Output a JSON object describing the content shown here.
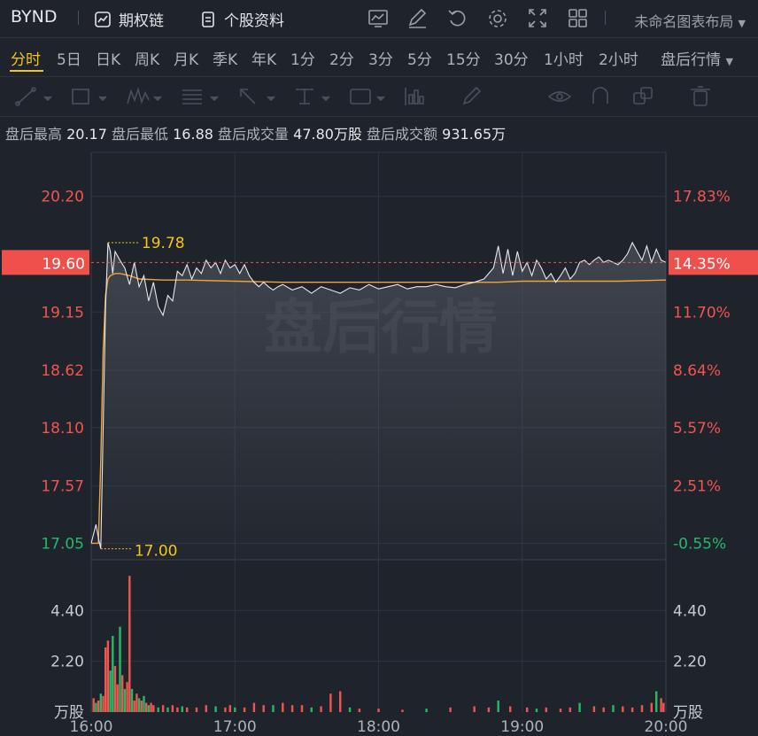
{
  "header": {
    "ticker": "BYND",
    "options_chain": "期权链",
    "stock_profile": "个股资料",
    "layout_name": "未命名图表布局",
    "icons": [
      "chart-icon",
      "edit-icon",
      "undo-icon",
      "settings-icon",
      "fullscreen-icon",
      "grid-icon"
    ]
  },
  "timeframes": {
    "items": [
      "分时",
      "5日",
      "日K",
      "周K",
      "月K",
      "季K",
      "年K",
      "1分",
      "2分",
      "3分",
      "5分",
      "15分",
      "30分",
      "1小时",
      "2小时"
    ],
    "active": "分时",
    "session": "盘后行情"
  },
  "drawing_tools": [
    "line-tool-icon",
    "rect-tool-icon",
    "pattern-tool-icon",
    "fib-tool-icon",
    "arrow-tool-icon",
    "measure-tool-icon",
    "text-tool-icon",
    "indicator-tool-icon",
    "pen-tool-icon",
    "eye-icon",
    "magnet-icon",
    "layers-icon",
    "trash-icon"
  ],
  "stats": {
    "high_label": "盘后最高",
    "high": "20.17",
    "low_label": "盘后最低",
    "low": "16.88",
    "volume_label": "盘后成交量",
    "volume": "47.80万股",
    "amount_label": "盘后成交额",
    "amount": "931.65万"
  },
  "chart_data": {
    "type": "line",
    "watermark": "盘后行情",
    "x_ticks": [
      "16:00",
      "17:00",
      "18:00",
      "19:00",
      "20:00"
    ],
    "y_ticks_price": [
      "20.20",
      "19.15",
      "18.62",
      "18.10",
      "17.57",
      "17.05"
    ],
    "y_ticks_pct": [
      "17.83%",
      "11.70%",
      "8.64%",
      "5.57%",
      "2.51%",
      "-0.55%"
    ],
    "y_ticks_price_values": [
      20.2,
      19.15,
      18.62,
      18.1,
      17.57,
      17.05
    ],
    "current_price": "19.60",
    "current_price_value": 19.6,
    "current_pct": "14.35%",
    "high_marker": "19.78",
    "high_marker_value": 19.78,
    "low_marker": "17.00",
    "low_marker_value": 17.0,
    "ylim": [
      16.9,
      20.6
    ],
    "price": {
      "t": [
        0,
        2,
        3,
        4,
        6,
        7,
        8,
        9,
        10,
        12,
        14,
        16,
        18,
        20,
        22,
        24,
        26,
        28,
        30,
        32,
        34,
        36,
        38,
        40,
        42,
        44,
        46,
        48,
        50,
        52,
        54,
        56,
        58,
        60,
        62,
        64,
        66,
        68,
        70,
        72,
        74,
        76,
        78,
        80,
        84,
        88,
        92,
        96,
        100,
        104,
        108,
        112,
        116,
        120,
        124,
        128,
        132,
        136,
        140,
        144,
        148,
        152,
        156,
        160,
        164,
        168,
        170,
        172,
        174,
        176,
        178,
        180,
        182,
        184,
        186,
        188,
        190,
        192,
        194,
        196,
        198,
        200,
        202,
        204,
        206,
        208,
        210,
        212,
        214,
        216,
        218,
        220,
        222,
        224,
        226,
        228,
        230,
        232,
        234,
        236,
        238,
        240
      ],
      "v": [
        17.05,
        17.22,
        17.1,
        17.0,
        19.2,
        19.78,
        19.7,
        19.5,
        19.7,
        19.62,
        19.55,
        19.4,
        19.6,
        19.38,
        19.48,
        19.25,
        19.42,
        19.2,
        19.12,
        19.3,
        19.25,
        19.52,
        19.48,
        19.58,
        19.45,
        19.55,
        19.5,
        19.62,
        19.55,
        19.6,
        19.5,
        19.62,
        19.55,
        19.58,
        19.5,
        19.58,
        19.48,
        19.42,
        19.38,
        19.42,
        19.38,
        19.35,
        19.38,
        19.4,
        19.35,
        19.38,
        19.32,
        19.38,
        19.35,
        19.32,
        19.37,
        19.35,
        19.4,
        19.36,
        19.38,
        19.4,
        19.36,
        19.38,
        19.38,
        19.4,
        19.38,
        19.37,
        19.4,
        19.42,
        19.45,
        19.55,
        19.75,
        19.5,
        19.72,
        19.48,
        19.7,
        19.52,
        19.6,
        19.48,
        19.62,
        19.55,
        19.45,
        19.5,
        19.42,
        19.48,
        19.55,
        19.45,
        19.5,
        19.6,
        19.62,
        19.58,
        19.62,
        19.65,
        19.6,
        19.62,
        19.6,
        19.58,
        19.62,
        19.68,
        19.78,
        19.7,
        19.62,
        19.75,
        19.6,
        19.72,
        19.62,
        19.6
      ]
    },
    "avg": {
      "t": [
        0,
        3,
        4,
        5,
        6,
        7,
        8,
        10,
        12,
        16,
        20,
        30,
        40,
        60,
        80,
        100,
        120,
        140,
        160,
        170,
        180,
        200,
        220,
        240
      ],
      "v": [
        17.05,
        17.05,
        17.8,
        18.8,
        19.3,
        19.45,
        19.48,
        19.5,
        19.5,
        19.48,
        19.45,
        19.44,
        19.44,
        19.43,
        19.42,
        19.42,
        19.42,
        19.42,
        19.42,
        19.42,
        19.43,
        19.43,
        19.43,
        19.44
      ]
    },
    "volume": {
      "unit": "万股",
      "ticks": [
        "4.40",
        "2.20"
      ],
      "tick_values": [
        4.4,
        2.2
      ],
      "bars": [
        [
          1,
          0.6,
          "r"
        ],
        [
          2,
          0.4,
          "g"
        ],
        [
          3,
          0.5,
          "r"
        ],
        [
          4,
          0.8,
          "g"
        ],
        [
          5,
          0.7,
          "r"
        ],
        [
          6,
          2.8,
          "r"
        ],
        [
          7,
          3.1,
          "r"
        ],
        [
          8,
          1.8,
          "g"
        ],
        [
          9,
          3.3,
          "g"
        ],
        [
          10,
          2.0,
          "r"
        ],
        [
          11,
          1.2,
          "r"
        ],
        [
          12,
          3.7,
          "g"
        ],
        [
          13,
          1.6,
          "r"
        ],
        [
          14,
          1.0,
          "g"
        ],
        [
          15,
          1.3,
          "r"
        ],
        [
          16,
          5.9,
          "r"
        ],
        [
          17,
          1.0,
          "g"
        ],
        [
          18,
          0.5,
          "r"
        ],
        [
          19,
          0.8,
          "r"
        ],
        [
          20,
          0.6,
          "g"
        ],
        [
          21,
          0.5,
          "r"
        ],
        [
          22,
          0.7,
          "g"
        ],
        [
          23,
          0.4,
          "r"
        ],
        [
          24,
          0.3,
          "g"
        ],
        [
          25,
          0.4,
          "r"
        ],
        [
          26,
          0.3,
          "r"
        ],
        [
          28,
          0.2,
          "g"
        ],
        [
          30,
          0.3,
          "r"
        ],
        [
          32,
          0.2,
          "g"
        ],
        [
          34,
          0.3,
          "r"
        ],
        [
          36,
          0.2,
          "r"
        ],
        [
          38,
          0.25,
          "g"
        ],
        [
          40,
          0.2,
          "r"
        ],
        [
          44,
          0.2,
          "r"
        ],
        [
          48,
          0.3,
          "r"
        ],
        [
          52,
          0.25,
          "g"
        ],
        [
          56,
          0.2,
          "r"
        ],
        [
          58,
          0.3,
          "r"
        ],
        [
          60,
          0.2,
          "g"
        ],
        [
          64,
          0.2,
          "r"
        ],
        [
          68,
          0.4,
          "r"
        ],
        [
          72,
          0.3,
          "r"
        ],
        [
          76,
          0.3,
          "g"
        ],
        [
          80,
          0.4,
          "r"
        ],
        [
          84,
          0.3,
          "r"
        ],
        [
          88,
          0.3,
          "r"
        ],
        [
          92,
          0.2,
          "g"
        ],
        [
          96,
          0.25,
          "r"
        ],
        [
          100,
          0.8,
          "r"
        ],
        [
          104,
          0.9,
          "r"
        ],
        [
          108,
          0.2,
          "g"
        ],
        [
          112,
          0.15,
          "r"
        ],
        [
          120,
          0.15,
          "r"
        ],
        [
          130,
          0.1,
          "r"
        ],
        [
          140,
          0.15,
          "g"
        ],
        [
          150,
          0.2,
          "r"
        ],
        [
          160,
          0.25,
          "r"
        ],
        [
          166,
          0.2,
          "r"
        ],
        [
          170,
          0.5,
          "g"
        ],
        [
          175,
          0.25,
          "r"
        ],
        [
          182,
          0.2,
          "r"
        ],
        [
          186,
          0.15,
          "g"
        ],
        [
          190,
          0.2,
          "r"
        ],
        [
          196,
          0.15,
          "r"
        ],
        [
          200,
          0.2,
          "r"
        ],
        [
          204,
          0.4,
          "g"
        ],
        [
          210,
          0.25,
          "r"
        ],
        [
          214,
          0.2,
          "r"
        ],
        [
          218,
          0.3,
          "g"
        ],
        [
          222,
          0.25,
          "r"
        ],
        [
          226,
          0.2,
          "r"
        ],
        [
          230,
          0.3,
          "r"
        ],
        [
          234,
          0.4,
          "r"
        ],
        [
          236,
          0.9,
          "g"
        ],
        [
          238,
          0.6,
          "r"
        ],
        [
          239,
          0.4,
          "r"
        ]
      ]
    },
    "x_minutes_range": [
      0,
      240
    ]
  },
  "colors": {
    "up": "#f0554f",
    "down": "#26b86b",
    "avg": "#f0a23c",
    "line": "#e6e8ec",
    "marker": "#f5c518",
    "grid": "#2e3440",
    "price_tag_bg": "#f0504c"
  }
}
